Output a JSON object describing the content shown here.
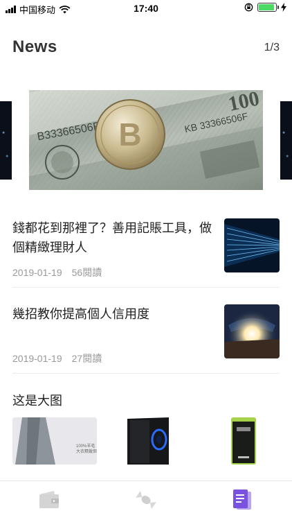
{
  "status_bar": {
    "carrier": "中国移动",
    "time": "17:40",
    "battery_level": 0.9,
    "colors": {
      "battery": "#4cd964"
    }
  },
  "header": {
    "title": "News",
    "pager": "1/3"
  },
  "articles": [
    {
      "title": "錢都花到那裡了？善用記賬工具，做個精緻理財人",
      "date": "2019-01-19",
      "reads": "56閱讀",
      "thumb_icon": "data-stream-image"
    },
    {
      "title": "幾招教你提高個人信用度",
      "date": "2019-01-19",
      "reads": "27閱讀",
      "thumb_icon": "car-light-image"
    }
  ],
  "section": {
    "title": "这是大图",
    "images": [
      "coat-image",
      "pc-case-image",
      "cosmetic-tube-image"
    ],
    "coat_caption_1": "100%羊毛",
    "coat_caption_2": "大衣精裁但大衣"
  },
  "tabs": [
    {
      "icon": "wallet-icon",
      "active": false
    },
    {
      "icon": "candy-icon",
      "active": false
    },
    {
      "icon": "document-icon",
      "active": true,
      "color": "#7b52e0"
    }
  ]
}
